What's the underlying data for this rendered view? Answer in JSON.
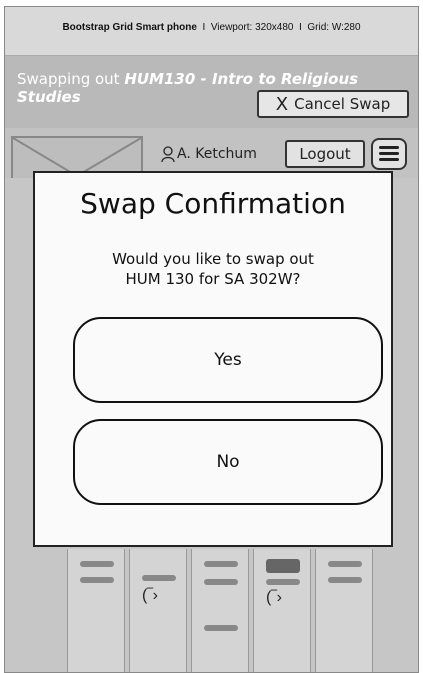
{
  "infobar": {
    "device": "Bootstrap Grid Smart phone",
    "separator": "I",
    "viewport": "Viewport: 320x480",
    "grid": "Grid: W:280"
  },
  "swapbar": {
    "prefix": "Swapping out ",
    "course": "HUM130 - Intro to Religious Studies",
    "cancel_label": "Cancel Swap"
  },
  "header": {
    "user_name": "A. Ketchum",
    "logout_label": "Logout"
  },
  "modal": {
    "title": "Swap Confirmation",
    "message_line1": "Would you like to swap out",
    "message_line2": "HUM 130 for SA 302W?",
    "yes_label": "Yes",
    "no_label": "No"
  }
}
